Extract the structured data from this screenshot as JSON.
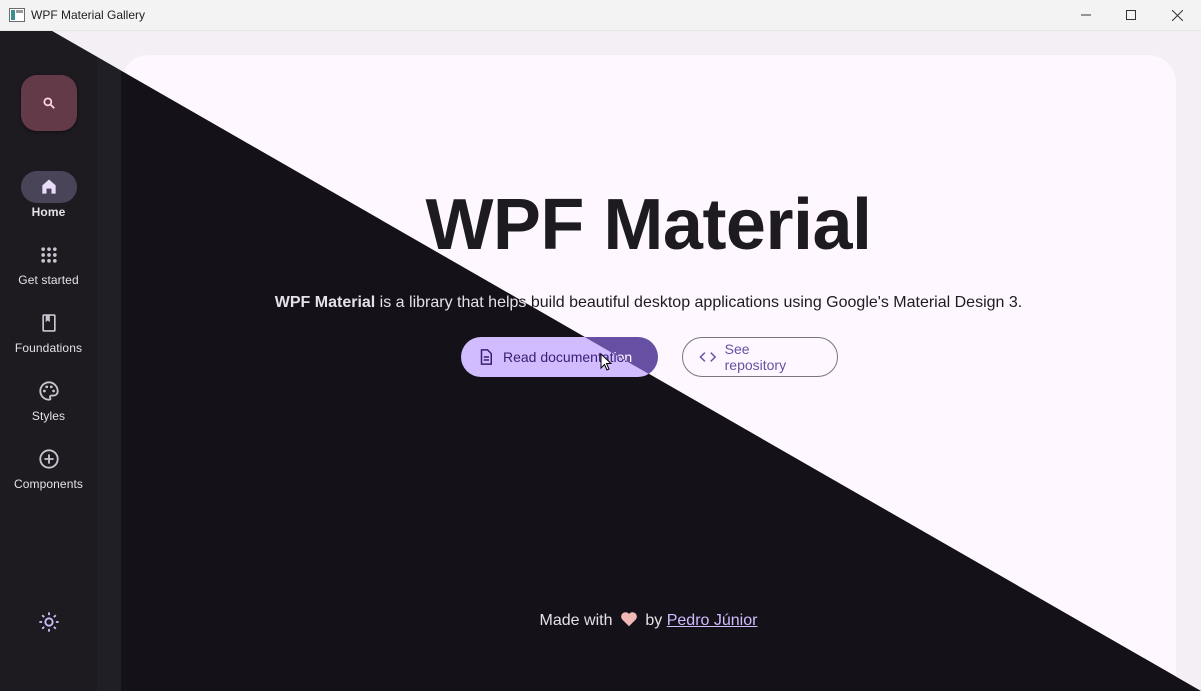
{
  "window": {
    "title": "WPF Material Gallery",
    "minimize_icon": "minimize-icon",
    "maximize_icon": "maximize-icon",
    "close_icon": "close-icon"
  },
  "rail": {
    "search_icon": "search-icon",
    "items": [
      {
        "label": "Home",
        "icon": "home-icon",
        "active": true
      },
      {
        "label": "Get started",
        "icon": "apps-grid-icon",
        "active": false
      },
      {
        "label": "Foundations",
        "icon": "bookmark-book-icon",
        "active": false
      },
      {
        "label": "Styles",
        "icon": "palette-icon",
        "active": false
      },
      {
        "label": "Components",
        "icon": "add-circle-icon",
        "active": false
      }
    ],
    "theme_toggle_icon": "sun-icon"
  },
  "hero": {
    "title": "WPF Material",
    "description_bold": "WPF Material",
    "description_rest": " is a library that helps build beautiful desktop applications using Google's Material Design 3.",
    "primary_button": {
      "label": "Read documentation",
      "icon": "document-icon"
    },
    "secondary_button": {
      "label": "See repository",
      "icon": "code-icon"
    }
  },
  "footer": {
    "prefix": "Made with",
    "icon": "heart-icon",
    "middle": "by",
    "author": "Pedro Júnior"
  },
  "colors": {
    "light_primary": "#6750a4",
    "dark_primary": "#d0bcff",
    "dark_background": "#141218",
    "light_surface": "#fef7ff",
    "heart": "#f2b8b5"
  }
}
